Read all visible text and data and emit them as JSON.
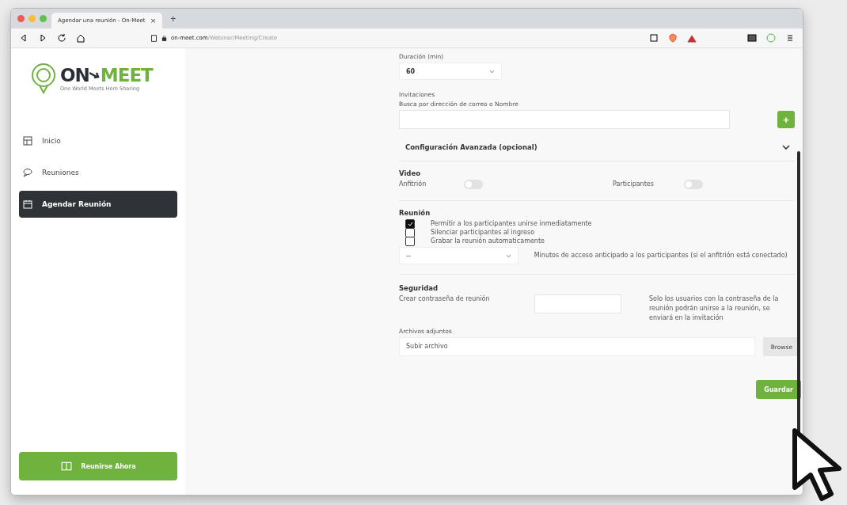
{
  "browser": {
    "tab_title": "Agendar una reunión - On-Meet",
    "tab_close": "×",
    "new_tab": "+",
    "url_host": "on-meet.com",
    "url_path": "/Webinar/Meeting/Create"
  },
  "sidebar": {
    "logo": {
      "brand_left": "ON",
      "brand_right": "MEET",
      "tagline": "One World Meets Here Sharing"
    },
    "items": [
      {
        "label": "Inicio",
        "kind": "dashboard",
        "selected": false
      },
      {
        "label": "Reuniones",
        "kind": "chat",
        "selected": false
      },
      {
        "label": "Agendar Reunión",
        "kind": "calendar",
        "selected": true
      }
    ],
    "join_button": "Reunirse Ahora"
  },
  "form": {
    "duration": {
      "label": "Duración (min)",
      "value": "60"
    },
    "invitations": {
      "title": "Invitaciones",
      "label": "Busca por dirección de correo o Nombre",
      "add": "+"
    },
    "advanced": {
      "title": "Configuración Avanzada (opcional)",
      "expanded": false
    },
    "video": {
      "title": "Video",
      "toggles": [
        {
          "label": "Anfitrión",
          "on": false
        },
        {
          "label": "Participantes",
          "on": false
        }
      ]
    },
    "meeting": {
      "title": "Reunión",
      "options": [
        {
          "label": "Permitir a los participantes unirse inmediatamente",
          "checked": true
        },
        {
          "label": "Silenciar participantes al ingreso",
          "checked": false
        },
        {
          "label": "Grabar la reunión automaticamente",
          "checked": false
        }
      ],
      "early_access": {
        "value": "--",
        "label": "Minutos de acceso anticipado a los participantes (si el anfitrión está conectado)"
      }
    },
    "security": {
      "title": "Seguridad",
      "password_label": "Crear contraseña de reunión",
      "note": "Solo los usuarios con la contraseña de la reunión podrán unirse a la reunión, se enviará en la invitación"
    },
    "attachments": {
      "label": "Archivos adjuntos",
      "placeholder": "Subir archivo",
      "browse": "Browse"
    },
    "save": "Guardar"
  }
}
